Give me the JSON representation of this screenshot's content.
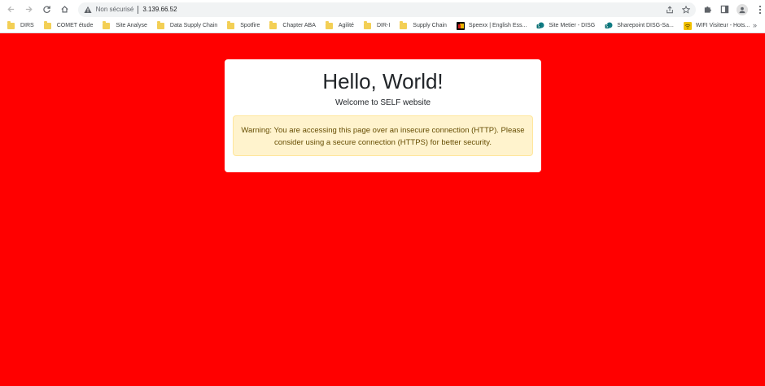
{
  "browser": {
    "security_label": "Non sécurisé",
    "url": "3.139.66.52",
    "icons": {
      "back": "arrow-left-icon",
      "forward": "arrow-right-icon",
      "reload": "reload-icon",
      "home": "home-icon",
      "warning": "warning-icon",
      "share": "share-icon",
      "bookmark_star": "star-icon",
      "extensions": "puzzle-icon",
      "side_panel": "side-panel-icon",
      "profile": "profile-icon",
      "menu": "kebab-menu-icon"
    }
  },
  "bookmarks": [
    {
      "label": "DIRS",
      "type": "folder"
    },
    {
      "label": "COMET étude",
      "type": "folder"
    },
    {
      "label": "Site Analyse",
      "type": "folder"
    },
    {
      "label": "Data Supply Chain",
      "type": "folder"
    },
    {
      "label": "Spotfire",
      "type": "folder"
    },
    {
      "label": "Chapter ABA",
      "type": "folder"
    },
    {
      "label": "Agilité",
      "type": "folder"
    },
    {
      "label": "DIR-I",
      "type": "folder"
    },
    {
      "label": "Supply Chain",
      "type": "folder"
    },
    {
      "label": "Speexx | English Ess...",
      "type": "site",
      "color": "#e8b300"
    },
    {
      "label": "Site Metier - DISG",
      "type": "site",
      "color": "#0f7b83"
    },
    {
      "label": "Sharepoint DISG-Sa...",
      "type": "site",
      "color": "#0f7b83"
    },
    {
      "label": "WIFI Visiteur - Hots...",
      "type": "site",
      "color": "#f2c200"
    }
  ],
  "bookmarks_overflow": "»",
  "page": {
    "background": "#ff0000",
    "title": "Hello, World!",
    "subtitle": "Welcome to SELF website",
    "warning": "Warning: You are accessing this page over an insecure connection (HTTP). Please consider using a secure connection (HTTPS) for better security."
  }
}
